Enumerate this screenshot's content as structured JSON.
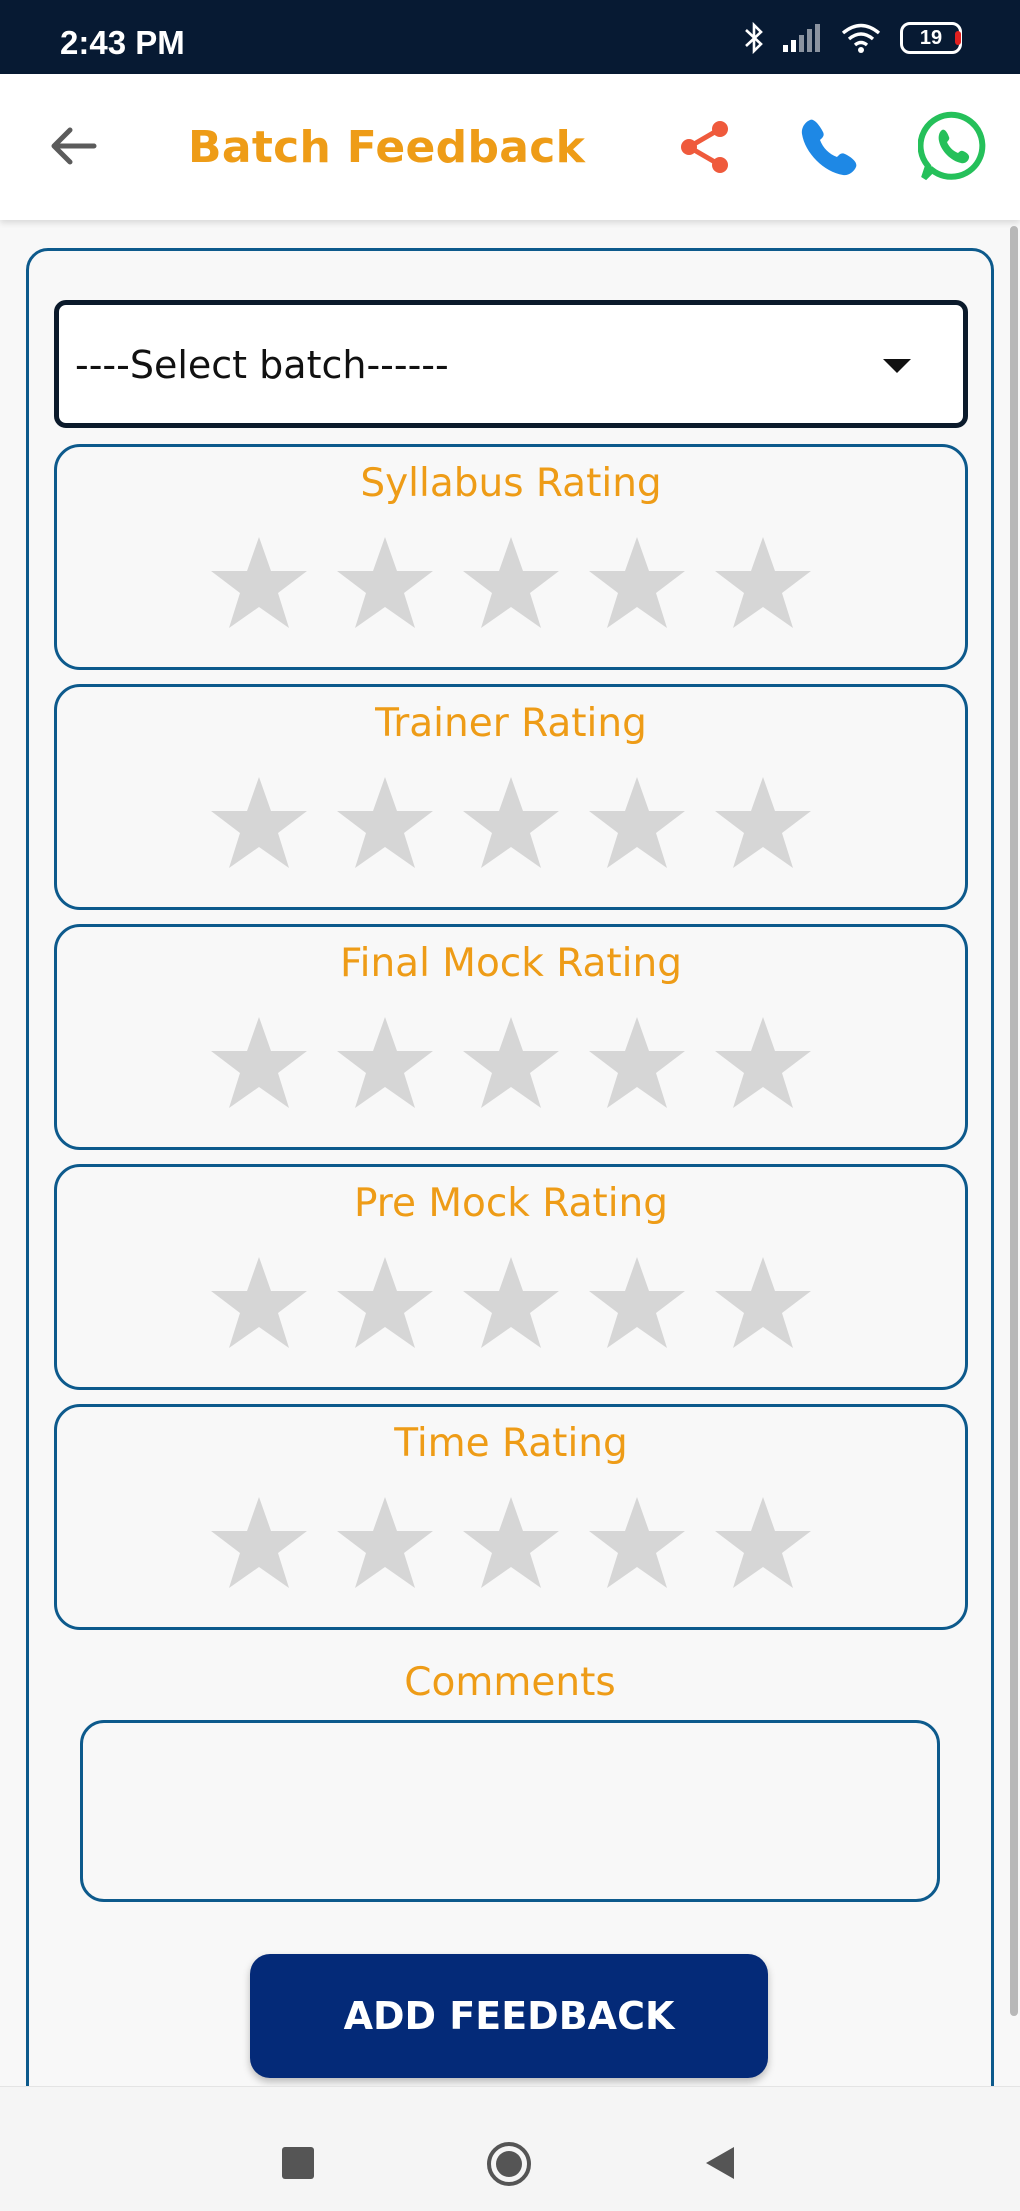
{
  "status_bar": {
    "time": "2:43 PM",
    "battery_level": "19",
    "icons": [
      "bluetooth-icon",
      "signal-icon",
      "wifi-icon",
      "battery-icon"
    ]
  },
  "app_bar": {
    "title": "Batch Feedback",
    "back_icon": "arrow-left-icon",
    "share_icon": "share-icon",
    "call_icon": "phone-icon",
    "whatsapp_icon": "whatsapp-icon"
  },
  "form": {
    "batch_select": {
      "selected_value": "----Select batch------"
    },
    "ratings": [
      {
        "label": "Syllabus Rating",
        "value": 0,
        "max": 5
      },
      {
        "label": "Trainer Rating",
        "value": 0,
        "max": 5
      },
      {
        "label": "Final Mock Rating",
        "value": 0,
        "max": 5
      },
      {
        "label": "Pre Mock Rating",
        "value": 0,
        "max": 5
      },
      {
        "label": "Time Rating",
        "value": 0,
        "max": 5
      }
    ],
    "comments_label": "Comments",
    "comments_value": "",
    "submit_label": "ADD FEEDBACK"
  },
  "colors": {
    "accent_orange": "#ee9c17",
    "border_blue": "#0d5a8c",
    "button_navy": "#042a78",
    "star_empty": "#d6d6d6",
    "share_red": "#ef5a3c",
    "phone_blue": "#1e88e5",
    "whatsapp_green": "#25c05a"
  },
  "nav_bar": {
    "icons": [
      "recents-square-icon",
      "home-circle-icon",
      "back-triangle-icon"
    ]
  }
}
